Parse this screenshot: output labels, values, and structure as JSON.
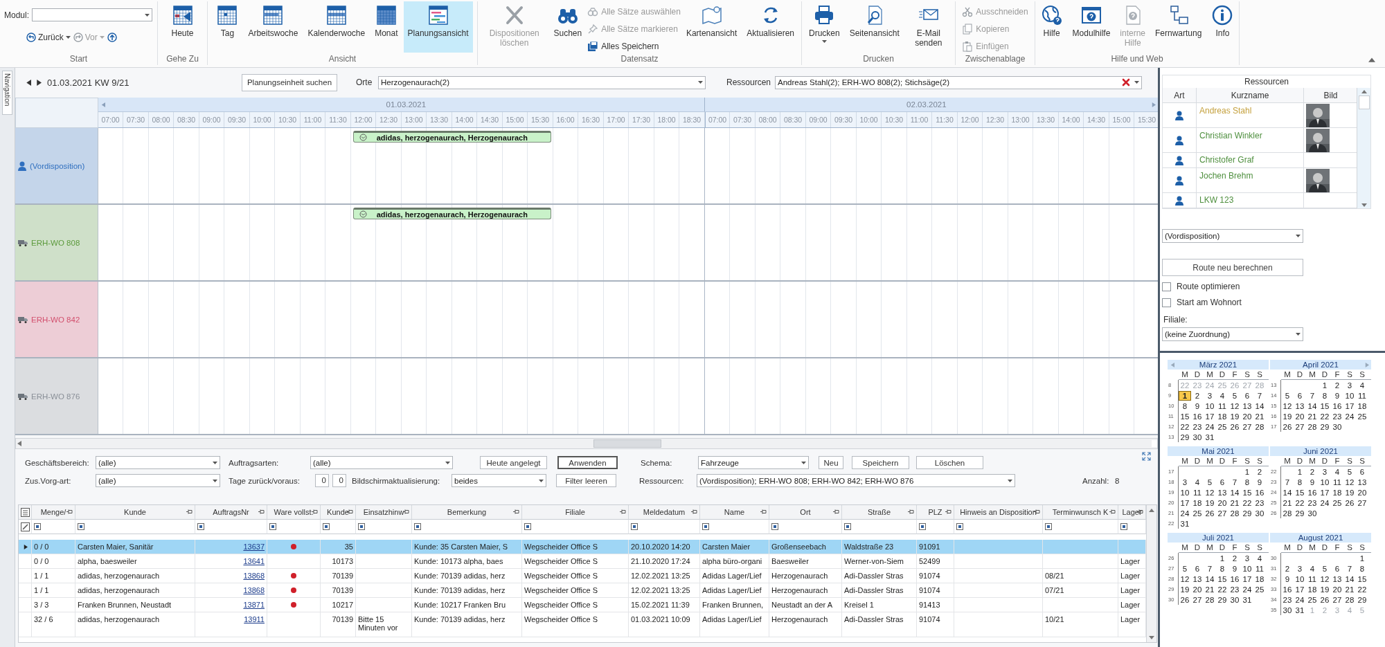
{
  "ribbon": {
    "module": {
      "label": "Modul:"
    },
    "nav": [
      {
        "label": "Zurück",
        "disabled": false
      },
      {
        "label": "Vor",
        "disabled": true
      }
    ],
    "groups": [
      {
        "label": "Start",
        "kind": "start"
      },
      {
        "label": "Gehe Zu",
        "kind": "buttons",
        "items": [
          {
            "kind": "large",
            "label": "Heute",
            "disabled": false,
            "selected": false
          }
        ]
      },
      {
        "label": "Ansicht",
        "kind": "buttons",
        "items": [
          {
            "kind": "large",
            "label": "Tag",
            "disabled": false,
            "selected": false
          },
          {
            "kind": "large",
            "label": "Arbeitswoche",
            "disabled": false,
            "selected": false
          },
          {
            "kind": "large",
            "label": "Kalenderwoche",
            "disabled": false,
            "selected": false
          },
          {
            "kind": "large",
            "label": "Monat",
            "disabled": false,
            "selected": false
          },
          {
            "kind": "large",
            "label": "Planungsansicht",
            "disabled": false,
            "selected": true
          }
        ]
      },
      {
        "label": "Datensatz",
        "kind": "buttons",
        "items": [
          {
            "kind": "large",
            "label": "Dispositionen löschen",
            "disabled": true,
            "selected": false
          },
          {
            "kind": "large",
            "label": "Suchen",
            "disabled": false,
            "selected": false
          },
          {
            "kind": "stack",
            "items": [
              {
                "label": "Alle Sätze auswählen",
                "disabled": true
              },
              {
                "label": "Alle Sätze markieren",
                "disabled": true
              },
              {
                "label": "Alles Speichern",
                "disabled": false
              }
            ]
          },
          {
            "kind": "large",
            "label": "Kartenansicht",
            "disabled": false,
            "selected": false
          },
          {
            "kind": "large",
            "label": "Aktualisieren",
            "disabled": false,
            "selected": false
          }
        ]
      },
      {
        "label": "Drucken",
        "kind": "buttons",
        "items": [
          {
            "kind": "large",
            "label": "Drucken",
            "disabled": false,
            "selected": false,
            "menu": true
          },
          {
            "kind": "large",
            "label": "Seitenansicht",
            "disabled": false,
            "selected": false
          },
          {
            "kind": "large",
            "label": "E-Mail senden",
            "disabled": false,
            "selected": false
          }
        ]
      },
      {
        "label": "Zwischenablage",
        "kind": "buttons",
        "items": [
          {
            "kind": "stack",
            "items": [
              {
                "label": "Ausschneiden",
                "disabled": true
              },
              {
                "label": "Kopieren",
                "disabled": true
              },
              {
                "label": "Einfügen",
                "disabled": true
              }
            ]
          }
        ]
      },
      {
        "label": "Hilfe und Web",
        "kind": "buttons",
        "items": [
          {
            "kind": "large",
            "label": "Hilfe",
            "disabled": false,
            "selected": false
          },
          {
            "kind": "large",
            "label": "Modulhilfe",
            "disabled": false,
            "selected": false
          },
          {
            "kind": "large",
            "label": "interne Hilfe",
            "disabled": true,
            "selected": false
          },
          {
            "kind": "large",
            "label": "Fernwartung",
            "disabled": false,
            "selected": false
          },
          {
            "kind": "large",
            "label": "Info",
            "disabled": false,
            "selected": false
          }
        ]
      }
    ]
  },
  "navigation_tab": "Navigation",
  "planner": {
    "date_label": "01.03.2021 KW 9/21",
    "search_button": "Planungseinheit suchen",
    "places": {
      "label": "Orte",
      "value": "Herzogenaurach(2)"
    },
    "resources": {
      "label": "Ressourcen",
      "value": "Andreas Stahl(2); ERH-WO 808(2); Stichsäge(2)"
    },
    "days": [
      {
        "date": "01.03.2021",
        "times": [
          "07:00",
          "07:30",
          "08:00",
          "08:30",
          "09:00",
          "09:30",
          "10:00",
          "10:30",
          "11:00",
          "11:30",
          "12:00",
          "12:30",
          "13:00",
          "13:30",
          "14:00",
          "14:30",
          "15:00",
          "15:30",
          "16:00",
          "16:30",
          "17:00",
          "17:30",
          "18:00",
          "18:30"
        ]
      },
      {
        "date": "02.03.2021",
        "times": [
          "07:00",
          "07:30",
          "08:00",
          "08:30",
          "09:00",
          "09:30",
          "10:00",
          "10:30",
          "11:00",
          "11:30",
          "12:00",
          "12:30",
          "13:00",
          "13:30",
          "14:00",
          "14:30",
          "15:00",
          "15:30"
        ]
      }
    ],
    "rows": [
      {
        "name": "(Vordisposition)",
        "kind": "person",
        "color": "#2f6fbf",
        "appointments": [
          {
            "label": "adidas, herzogenaurach, Herzogenaurach"
          }
        ]
      },
      {
        "name": "ERH-WO 808",
        "kind": "vehicle",
        "color": "#5c9a3c",
        "appointments": [
          {
            "label": "adidas, herzogenaurach, Herzogenaurach"
          }
        ]
      },
      {
        "name": "ERH-WO 842",
        "kind": "vehicle",
        "color": "#d2506e",
        "appointments": []
      },
      {
        "name": "ERH-WO 876",
        "kind": "vehicle",
        "color": "#8a9098",
        "appointments": []
      }
    ]
  },
  "filters": {
    "rows": [
      {
        "items": [
          {
            "kind": "label",
            "text": "Geschäftsbereich:"
          },
          {
            "kind": "select",
            "value": "(alle)"
          },
          {
            "kind": "label",
            "text": "Auftragsarten:"
          },
          {
            "kind": "select",
            "value": "(alle)"
          },
          {
            "kind": "button",
            "text": "Heute angelegt",
            "focused": false
          },
          {
            "kind": "button",
            "text": "Anwenden",
            "focused": true
          },
          {
            "kind": "label",
            "text": "Schema:"
          },
          {
            "kind": "select",
            "value": "Fahrzeuge"
          },
          {
            "kind": "button",
            "text": "Neu",
            "focused": false
          },
          {
            "kind": "button",
            "text": "Speichern",
            "focused": false
          },
          {
            "kind": "button",
            "text": "Löschen",
            "focused": false
          }
        ]
      },
      {
        "items": [
          {
            "kind": "label",
            "text": "Zus.Vorg-art:"
          },
          {
            "kind": "select",
            "value": "(alle)"
          },
          {
            "kind": "label",
            "text": "Tage zurück/voraus:"
          },
          {
            "kind": "number",
            "value": "0"
          },
          {
            "kind": "number",
            "value": "0"
          },
          {
            "kind": "label",
            "text": "Bildschirmaktualisierung:"
          },
          {
            "kind": "select",
            "value": "beides"
          },
          {
            "kind": "button",
            "text": "Filter leeren",
            "focused": false
          },
          {
            "kind": "label",
            "text": "Ressourcen:"
          },
          {
            "kind": "select",
            "value": "(Vordisposition); ERH-WO 808; ERH-WO 842; ERH-WO 876"
          },
          {
            "kind": "label",
            "text": "Anzahl:"
          },
          {
            "kind": "label",
            "text": "8"
          }
        ]
      }
    ]
  },
  "orders": {
    "columns": [
      "Menge/",
      "Kunde",
      "AuftragsNr",
      "Ware vollst.",
      "Kunde",
      "Einsatzhinw",
      "Bemerkung",
      "Filiale",
      "Meldedatum",
      "Name",
      "Ort",
      "Straße",
      "PLZ",
      "Hinweis an Disposition",
      "Terminwunsch K",
      "Lager"
    ],
    "rows": [
      {
        "selected": true,
        "complete": true,
        "menge": "0 / 0",
        "kunde": "Carsten Maier, Sanitär",
        "auftragsnr": "13637",
        "kunde_nr": "35",
        "bemerkung": "Kunde: 35 Carsten Maier, S",
        "filiale": "Wegscheider Office S",
        "meldedatum": "20.10.2020 14:20",
        "name": "Carsten Maier",
        "ort": "Großenseebach",
        "strasse": "Waldstraße 23",
        "plz": "91091"
      },
      {
        "selected": false,
        "complete": false,
        "menge": "0 / 0",
        "kunde": "alpha, baesweiler",
        "auftragsnr": "13641",
        "kunde_nr": "10173",
        "bemerkung": "Kunde: 10173 alpha, baes",
        "filiale": "Wegscheider Office S",
        "meldedatum": "21.10.2020 17:24",
        "name": "alpha büro-organi",
        "ort": "Baesweiler",
        "strasse": "Werner-von-Siem",
        "plz": "52499",
        "lager": "Lager"
      },
      {
        "selected": false,
        "complete": true,
        "menge": "1 / 1",
        "kunde": "adidas, herzogenaurach",
        "auftragsnr": "13868",
        "kunde_nr": "70139",
        "bemerkung": "Kunde: 70139 adidas, herz",
        "filiale": "Wegscheider Office S",
        "meldedatum": "12.02.2021 13:25",
        "name": "Adidas Lager/Lief",
        "ort": "Herzogenaurach",
        "strasse": "Adi-Dassler Stras",
        "plz": "91074",
        "termin": "08/21",
        "lager": "Lager"
      },
      {
        "selected": false,
        "complete": true,
        "menge": "1 / 1",
        "kunde": "adidas, herzogenaurach",
        "auftragsnr": "13868",
        "kunde_nr": "70139",
        "bemerkung": "Kunde: 70139 adidas, herz",
        "filiale": "Wegscheider Office S",
        "meldedatum": "12.02.2021 13:25",
        "name": "Adidas Lager/Lief",
        "ort": "Herzogenaurach",
        "strasse": "Adi-Dassler Stras",
        "plz": "91074",
        "termin": "07/21",
        "lager": "Lager"
      },
      {
        "selected": false,
        "complete": true,
        "menge": "3 / 3",
        "kunde": "Franken Brunnen, Neustadt",
        "auftragsnr": "13871",
        "kunde_nr": "10217",
        "bemerkung": "Kunde: 10217 Franken Bru",
        "filiale": "Wegscheider Office S",
        "meldedatum": "15.02.2021 11:39",
        "name": "Franken Brunnen,",
        "ort": "Neustadt an der A",
        "strasse": "Kreisel 1",
        "plz": "91413",
        "lager": "Lager"
      },
      {
        "selected": false,
        "complete": false,
        "menge": "32 / 6",
        "kunde": "adidas, herzogenaurach",
        "auftragsnr": "13911",
        "kunde_nr": "70139",
        "einsatz": "Bitte 15 Minuten vor",
        "bemerkung": "Kunde: 70139 adidas, herz",
        "filiale": "Wegscheider Office S",
        "meldedatum": "01.03.2021 10:09",
        "name": "Adidas Lager/Lief",
        "ort": "Herzogenaurach",
        "strasse": "Adi-Dassler Stras",
        "plz": "91074",
        "termin": "10/21",
        "lager": "Lager"
      }
    ]
  },
  "resource_panel": {
    "title": "Ressourcen",
    "columns": [
      "Art",
      "Kurzname",
      "Bild"
    ],
    "rows": [
      {
        "name": "Andreas Stahl",
        "color": "#c4a03c",
        "photo": true
      },
      {
        "name": "Christian Winkler",
        "color": "#4e8f3e",
        "photo": true
      },
      {
        "name": "Christofer Graf",
        "color": "#4e8f3e",
        "photo": false
      },
      {
        "name": "Jochen Brehm",
        "color": "#4e8f3e",
        "photo": true
      },
      {
        "name": "LKW 123",
        "color": "#4e8f3e",
        "photo": false
      }
    ],
    "assignment": {
      "value": "(Vordisposition)"
    },
    "route_button": "Route neu berechnen",
    "options": [
      {
        "label": "Route optimieren",
        "checked": false
      },
      {
        "label": "Start am Wohnort",
        "checked": false
      }
    ],
    "branch": {
      "label": "Filiale:",
      "value": "(keine Zuordnung)"
    }
  },
  "calendar": {
    "months": [
      {
        "title": "März 2021",
        "weekdays": [
          "M",
          "D",
          "M",
          "D",
          "F",
          "S",
          "S"
        ],
        "weeks": [
          {
            "number": "8",
            "days": [
              {
                "day": "22",
                "muted": true
              },
              {
                "day": "23",
                "muted": true
              },
              {
                "day": "24",
                "muted": true
              },
              {
                "day": "25",
                "muted": true
              },
              {
                "day": "26",
                "muted": true
              },
              {
                "day": "27",
                "muted": true
              },
              {
                "day": "28",
                "muted": true
              }
            ]
          },
          {
            "number": "9",
            "days": [
              {
                "day": "1",
                "selected": true
              },
              "2",
              "3",
              "4",
              "5",
              "6",
              "7"
            ]
          },
          {
            "number": "10",
            "days": [
              "8",
              "9",
              "10",
              "11",
              "12",
              "13",
              "14"
            ]
          },
          {
            "number": "11",
            "days": [
              "15",
              "16",
              "17",
              "18",
              "19",
              "20",
              "21"
            ]
          },
          {
            "number": "12",
            "days": [
              "22",
              "23",
              "24",
              "25",
              "26",
              "27",
              "28"
            ]
          },
          {
            "number": "13",
            "days": [
              "29",
              "30",
              "31"
            ]
          }
        ]
      },
      {
        "title": "April 2021",
        "weekdays": [
          "M",
          "D",
          "M",
          "D",
          "F",
          "S",
          "S"
        ],
        "weeks": [
          {
            "number": "13",
            "days": [
              "1",
              "2",
              "3",
              "4"
            ]
          },
          {
            "number": "14",
            "days": [
              "5",
              "6",
              "7",
              "8",
              "9",
              "10",
              "11"
            ]
          },
          {
            "number": "15",
            "days": [
              "12",
              "13",
              "14",
              "15",
              "16",
              "17",
              "18"
            ]
          },
          {
            "number": "16",
            "days": [
              "19",
              "20",
              "21",
              "22",
              "23",
              "24",
              "25"
            ]
          },
          {
            "number": "17",
            "days": [
              "26",
              "27",
              "28",
              "29",
              "30"
            ]
          }
        ]
      },
      {
        "title": "Mai 2021",
        "weekdays": [
          "M",
          "D",
          "M",
          "D",
          "F",
          "S",
          "S"
        ],
        "weeks": [
          {
            "number": "17",
            "days": [
              "1",
              "2"
            ]
          },
          {
            "number": "18",
            "days": [
              "3",
              "4",
              "5",
              "6",
              "7",
              "8",
              "9"
            ]
          },
          {
            "number": "19",
            "days": [
              "10",
              "11",
              "12",
              "13",
              "14",
              "15",
              "16"
            ]
          },
          {
            "number": "20",
            "days": [
              "17",
              "18",
              "19",
              "20",
              "21",
              "22",
              "23"
            ]
          },
          {
            "number": "21",
            "days": [
              "24",
              "25",
              "26",
              "27",
              "28",
              "29",
              "30"
            ]
          },
          {
            "number": "22",
            "days": [
              "31"
            ]
          }
        ]
      },
      {
        "title": "Juni 2021",
        "weekdays": [
          "M",
          "D",
          "M",
          "D",
          "F",
          "S",
          "S"
        ],
        "weeks": [
          {
            "number": "22",
            "days": [
              "1",
              "2",
              "3",
              "4",
              "5",
              "6"
            ]
          },
          {
            "number": "23",
            "days": [
              "7",
              "8",
              "9",
              "10",
              "11",
              "12",
              "13"
            ]
          },
          {
            "number": "24",
            "days": [
              "14",
              "15",
              "16",
              "17",
              "18",
              "19",
              "20"
            ]
          },
          {
            "number": "25",
            "days": [
              "21",
              "22",
              "23",
              "24",
              "25",
              "26",
              "27"
            ]
          },
          {
            "number": "26",
            "days": [
              "28",
              "29",
              "30"
            ]
          }
        ]
      },
      {
        "title": "Juli 2021",
        "weekdays": [
          "M",
          "D",
          "M",
          "D",
          "F",
          "S",
          "S"
        ],
        "weeks": [
          {
            "number": "26",
            "days": [
              "1",
              "2",
              "3",
              "4"
            ]
          },
          {
            "number": "27",
            "days": [
              "5",
              "6",
              "7",
              "8",
              "9",
              "10",
              "11"
            ]
          },
          {
            "number": "28",
            "days": [
              "12",
              "13",
              "14",
              "15",
              "16",
              "17",
              "18"
            ]
          },
          {
            "number": "29",
            "days": [
              "19",
              "20",
              "21",
              "22",
              "23",
              "24",
              "25"
            ]
          },
          {
            "number": "30",
            "days": [
              "26",
              "27",
              "28",
              "29",
              "30",
              "31"
            ]
          }
        ]
      },
      {
        "title": "August 2021",
        "weekdays": [
          "M",
          "D",
          "M",
          "D",
          "F",
          "S",
          "S"
        ],
        "weeks": [
          {
            "number": "30",
            "days": [
              "1"
            ]
          },
          {
            "number": "31",
            "days": [
              "2",
              "3",
              "4",
              "5",
              "6",
              "7",
              "8"
            ]
          },
          {
            "number": "32",
            "days": [
              "9",
              "10",
              "11",
              "12",
              "13",
              "14",
              "15"
            ]
          },
          {
            "number": "33",
            "days": [
              "16",
              "17",
              "18",
              "19",
              "20",
              "21",
              "22"
            ]
          },
          {
            "number": "34",
            "days": [
              "23",
              "24",
              "25",
              "26",
              "27",
              "28",
              "29"
            ]
          },
          {
            "number": "35",
            "days": [
              "30",
              "31",
              {
                "day": "1",
                "muted": true
              },
              {
                "day": "2",
                "muted": true
              },
              {
                "day": "3",
                "muted": true
              },
              {
                "day": "4",
                "muted": true
              },
              {
                "day": "5",
                "muted": true
              }
            ]
          }
        ]
      }
    ]
  }
}
